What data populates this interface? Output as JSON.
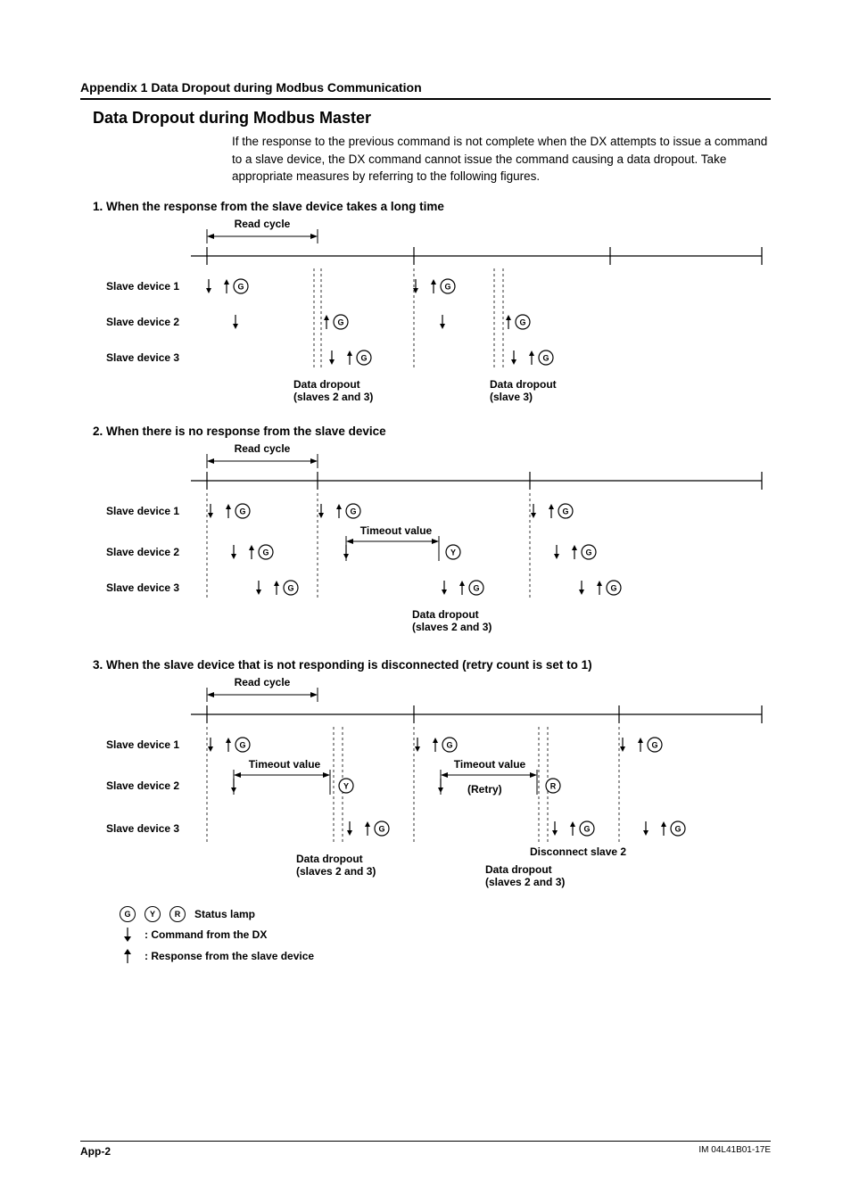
{
  "header": {
    "appendix": "Appendix 1  Data Dropout during Modbus Communication"
  },
  "section": {
    "title": "Data Dropout during Modbus Master",
    "intro": "If the response to the previous command is not complete when the DX attempts to issue a command to a slave device, the DX command cannot issue the command causing a data dropout. Take appropriate measures by referring to the following figures."
  },
  "cases": {
    "c1": {
      "title": "1. When the response from the slave device takes a long time"
    },
    "c2": {
      "title": "2. When there is no response from the slave device"
    },
    "c3": {
      "title": "3. When the slave device that is not responding is disconnected (retry count is set to 1)"
    }
  },
  "labels": {
    "read_cycle": "Read cycle",
    "slave1": "Slave device 1",
    "slave2": "Slave device 2",
    "slave3": "Slave device 3",
    "timeout": "Timeout value",
    "retry": "(Retry)",
    "dd_23": "Data dropout\n(slaves 2 and 3)",
    "dd_3": "Data dropout\n(slave 3)",
    "disc2": "Disconnect slave 2"
  },
  "lamps": {
    "g": "G",
    "y": "Y",
    "r": "R"
  },
  "legend": {
    "status": "Status lamp",
    "cmd": ":  Command from the DX",
    "resp": ":  Response from the slave device"
  },
  "footer": {
    "page": "App-2",
    "doc": "IM 04L41B01-17E"
  }
}
